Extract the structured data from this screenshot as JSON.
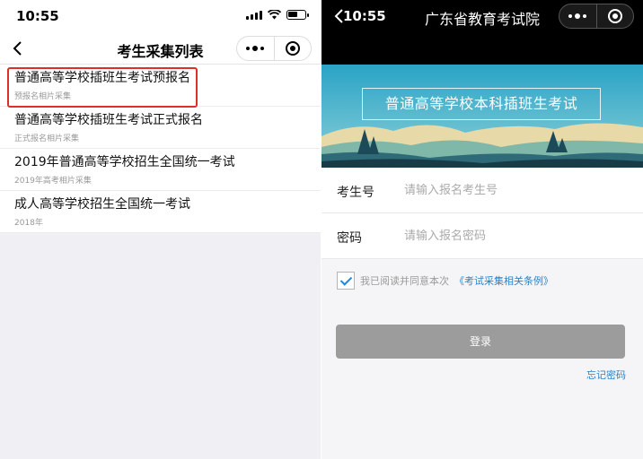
{
  "left": {
    "status": {
      "time": "10:55"
    },
    "navbar": {
      "title": "考生采集列表"
    },
    "items": [
      {
        "title": "普通高等学校插班生考试预报名",
        "subtitle": "预报名相片采集",
        "highlighted": true
      },
      {
        "title": "普通高等学校插班生考试正式报名",
        "subtitle": "正式报名相片采集"
      },
      {
        "title": "2019年普通高等学校招生全国统一考试",
        "subtitle": "2019年高考相片采集"
      },
      {
        "title": "成人高等学校招生全国统一考试",
        "subtitle": "2018年"
      }
    ]
  },
  "right": {
    "status": {
      "time": "10:55"
    },
    "navbar": {
      "title": "广东省教育考试院"
    },
    "banner": {
      "title": "普通高等学校本科插班生考试"
    },
    "form": {
      "id_label": "考生号",
      "id_placeholder": "请输入报名考生号",
      "pwd_label": "密码",
      "pwd_placeholder": "请输入报名密码"
    },
    "agree": {
      "text": "我已阅读并同意本次",
      "link": "《考试采集相关条例》",
      "checked": true
    },
    "login_label": "登录",
    "forgot_label": "忘记密码"
  },
  "colors": {
    "highlight_border": "#d9302c",
    "link": "#2a83c9",
    "button": "#9c9c9c"
  }
}
